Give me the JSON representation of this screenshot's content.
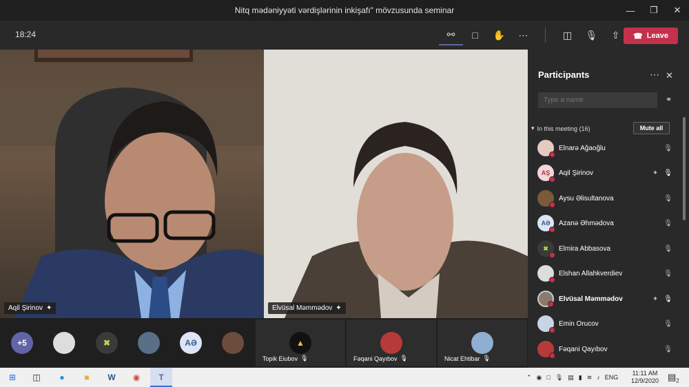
{
  "window": {
    "title": "Nitq mədəniyyəti vərdişlərinin inkişafı\" mövzusunda seminar"
  },
  "toolbar": {
    "time": "18:24",
    "leave_label": "Leave"
  },
  "videos": [
    {
      "name": "Aqil Şirinov"
    },
    {
      "name": "Elvüsal Məmmədov"
    }
  ],
  "strip": {
    "overflow": "+5",
    "initials_avatar": "AƏ",
    "tiles": [
      {
        "name": "Topik Eiubov"
      },
      {
        "name": "Fəqani Qayıbov"
      },
      {
        "name": "Nicat Ehtibar"
      }
    ]
  },
  "panel": {
    "title": "Participants",
    "search_placeholder": "Type a name",
    "section_label": "In this meeting (16)",
    "mute_all_label": "Mute all",
    "participants": [
      {
        "name": "Elnarə Ağaoğlu",
        "initials": "",
        "bold": false
      },
      {
        "name": "Aqil Şirinov",
        "initials": "AŞ",
        "bold": false
      },
      {
        "name": "Aysu Əlisultanova",
        "initials": "",
        "bold": false
      },
      {
        "name": "Azanə Əhmədova",
        "initials": "AƏ",
        "bold": false
      },
      {
        "name": "Elmira Abbasova",
        "initials": "",
        "bold": false
      },
      {
        "name": "Elshan Allahkverdiev",
        "initials": "",
        "bold": false
      },
      {
        "name": "Elvüsal Məmmədov",
        "initials": "",
        "bold": true
      },
      {
        "name": "Emin Orucov",
        "initials": "",
        "bold": false
      },
      {
        "name": "Fəqani Qayıbov",
        "initials": "",
        "bold": false
      }
    ]
  },
  "taskbar": {
    "time": "11:11 AM",
    "date": "12/9/2020",
    "lang": "ENG",
    "notif_count": "2"
  },
  "colors": {
    "leave": "#c4314b",
    "accent": "#6264a7",
    "background": "#1f1f1f"
  }
}
